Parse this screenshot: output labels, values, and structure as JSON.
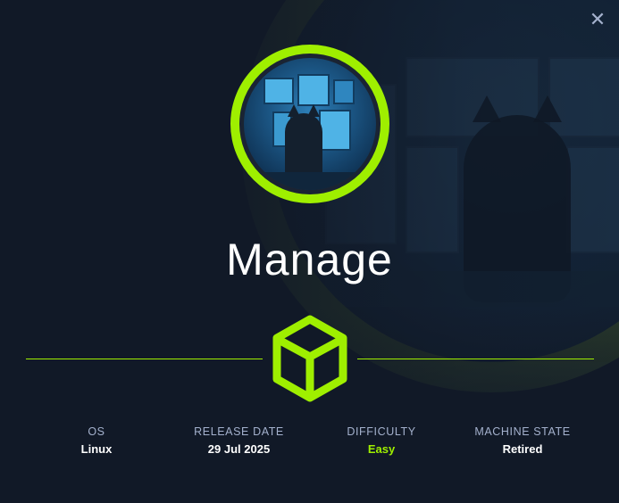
{
  "machine": {
    "name": "Manage"
  },
  "close_icon": "close-icon",
  "difficulty_icon": "cube-icon",
  "colors": {
    "accent": "#9fef00",
    "background": "#111927",
    "label": "#a4b1cd",
    "value": "#ffffff"
  },
  "stats": {
    "os": {
      "label": "OS",
      "value": "Linux"
    },
    "release_date": {
      "label": "RELEASE DATE",
      "value": "29 Jul 2025"
    },
    "difficulty": {
      "label": "DIFFICULTY",
      "value": "Easy"
    },
    "machine_state": {
      "label": "MACHINE STATE",
      "value": "Retired"
    }
  }
}
